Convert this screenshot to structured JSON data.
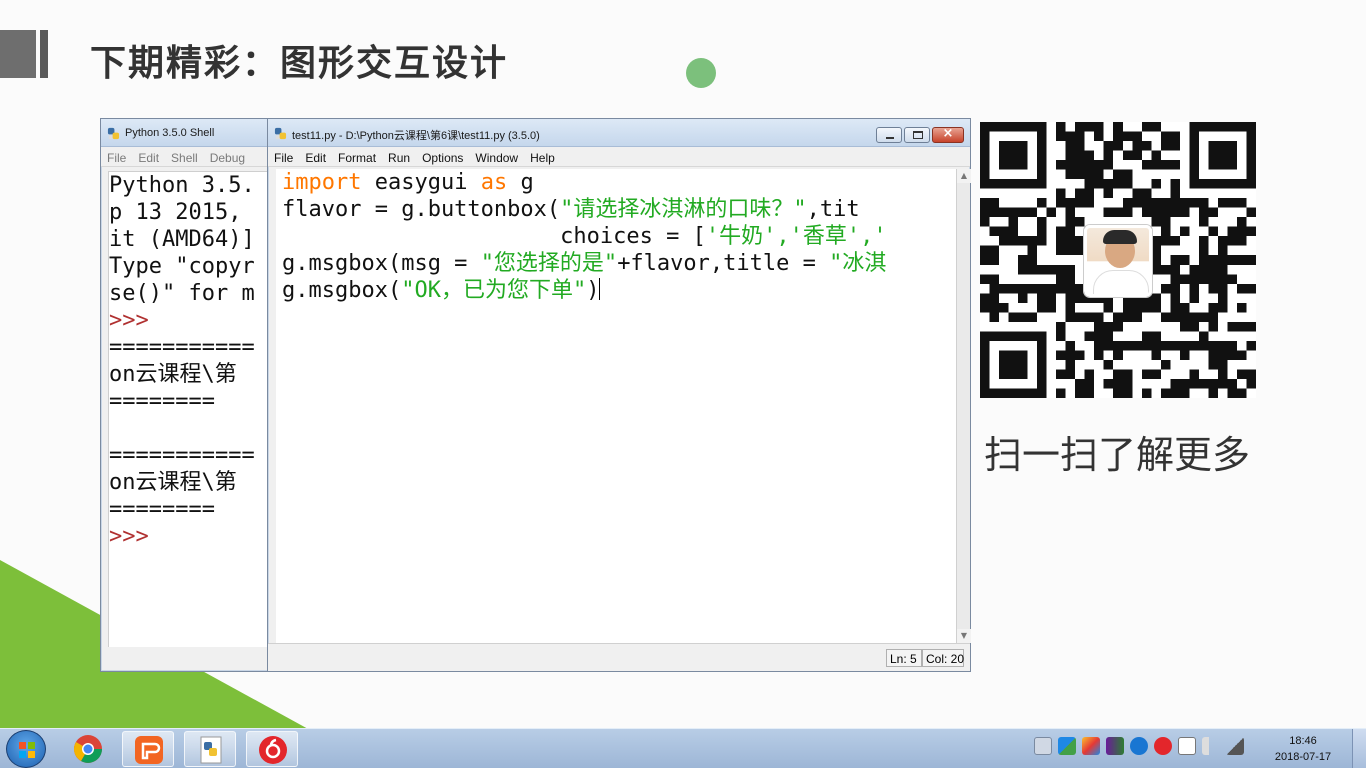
{
  "slide": {
    "title": "下期精彩：图形交互设计",
    "qr_caption": "扫一扫了解更多",
    "accent_green": "#7dbf3a"
  },
  "shell_window": {
    "title": "Python 3.5.0 Shell",
    "menu": [
      "File",
      "Edit",
      "Shell",
      "Debug"
    ],
    "lines": [
      "Python 3.5.",
      "p 13 2015,",
      "it (AMD64)]",
      "Type \"copyr",
      "se()\" for m",
      ">>>",
      "===========",
      "on云课程\\第",
      "========",
      "",
      "===========",
      "on云课程\\第",
      "========",
      ">>>"
    ]
  },
  "editor_window": {
    "title": "test11.py - D:\\Python云课程\\第6课\\test11.py (3.5.0)",
    "menu": [
      "File",
      "Edit",
      "Format",
      "Run",
      "Options",
      "Window",
      "Help"
    ],
    "code": {
      "l1_kw1": "import",
      "l1_mid": " easygui ",
      "l1_kw2": "as",
      "l1_end": " g",
      "l2_pre": "flavor = g.buttonbox(",
      "l2_str": "\"请选择冰淇淋的口味？\"",
      "l2_post": ",tit",
      "l3_pre": "                     choices = [",
      "l3_str": "'牛奶','香草','",
      "l4_pre": "g.msgbox(msg = ",
      "l4_str1": "\"您选择的是\"",
      "l4_mid": "+flavor,title = ",
      "l4_str2": "\"冰淇",
      "l5_pre": "g.msgbox(",
      "l5_str": "\"OK，已为您下单\"",
      "l5_post": ")"
    },
    "status_ln": "Ln: 5",
    "status_col": "Col: 20"
  },
  "taskbar": {
    "clock_time": "18:46",
    "clock_date": "2018-07-17",
    "items": [
      "start-button",
      "chrome",
      "wps-presentation",
      "python-idle",
      "netease-music"
    ],
    "tray_icons": [
      "keyboard-icon",
      "adobe-icon",
      "colorful-cube-icon",
      "network-app-icon",
      "cloud-icon",
      "netease-tray-icon",
      "clipboard-icon",
      "volume-icon",
      "signal-icon"
    ]
  }
}
